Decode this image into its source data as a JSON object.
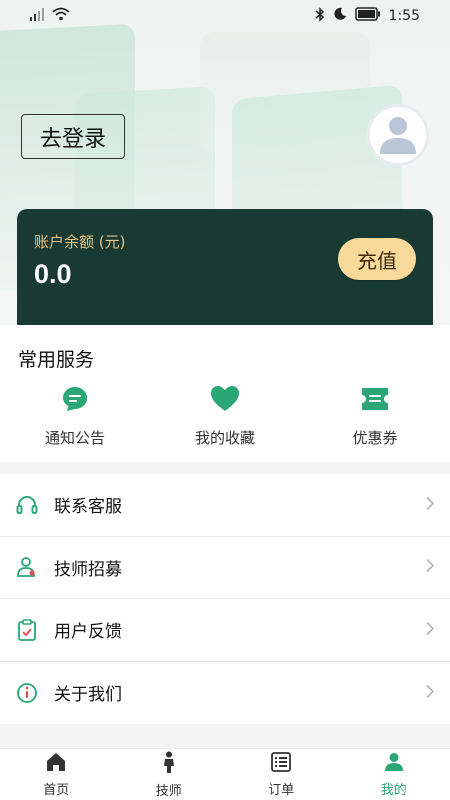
{
  "status_bar": {
    "time": "1:55"
  },
  "header": {
    "login_label": "去登录"
  },
  "balance": {
    "label": "账户余额 (元)",
    "value": "0.0",
    "recharge_label": "充值"
  },
  "services": {
    "title": "常用服务",
    "items": [
      {
        "label": "通知公告",
        "icon": "chat-bubble-icon"
      },
      {
        "label": "我的收藏",
        "icon": "heart-icon"
      },
      {
        "label": "优惠券",
        "icon": "ticket-icon"
      }
    ]
  },
  "menu": {
    "items": [
      {
        "label": "联系客服",
        "icon": "headset-icon"
      },
      {
        "label": "技师招募",
        "icon": "technician-icon"
      },
      {
        "label": "用户反馈",
        "icon": "clipboard-icon"
      },
      {
        "label": "关于我们",
        "icon": "info-icon"
      }
    ]
  },
  "tabbar": {
    "items": [
      {
        "label": "首页",
        "icon": "home-icon"
      },
      {
        "label": "技师",
        "icon": "person-icon"
      },
      {
        "label": "订单",
        "icon": "list-icon"
      },
      {
        "label": "我的",
        "icon": "profile-icon",
        "active": true
      }
    ]
  },
  "colors": {
    "accent": "#2aa775",
    "card_bg": "#193a33",
    "gold": "#e6c485",
    "recharge_bg": "#f9d99a"
  }
}
